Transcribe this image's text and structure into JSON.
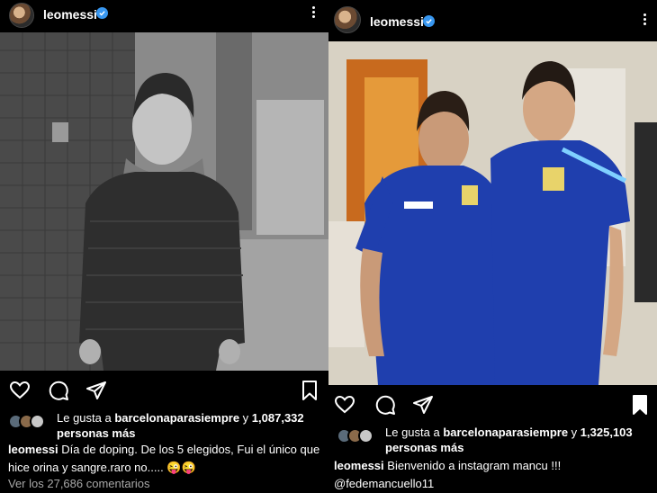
{
  "posts": [
    {
      "username": "leomessi",
      "liked_by_prefix": "Le gusta a ",
      "liked_by_user": "barcelonaparasiempre",
      "liked_by_mid": " y ",
      "likes_count": "1,087,332",
      "likes_suffix": "personas más",
      "caption_user": "leomessi",
      "caption_text": " Día de doping. De los 5 elegidos, Fui el único que hice orina y sangre.raro no..... 😜😜",
      "comments_link": "Ver los 27,686 comentarios"
    },
    {
      "username": "leomessi",
      "liked_by_prefix": "Le gusta a ",
      "liked_by_user": "barcelonaparasiempre",
      "liked_by_mid": " y ",
      "likes_count": "1,325,103",
      "likes_suffix": "personas más",
      "caption_user": "leomessi",
      "caption_text": " Bienvenido a instagram mancu !!! @fedemancuello11"
    }
  ],
  "icons": [
    "verified-badge-icon",
    "more-options-icon",
    "heart-icon",
    "comment-icon",
    "share-icon",
    "bookmark-icon"
  ],
  "colors": {
    "background": "#000000",
    "verified": "#3897f0",
    "muted": "#a8a8a8"
  }
}
